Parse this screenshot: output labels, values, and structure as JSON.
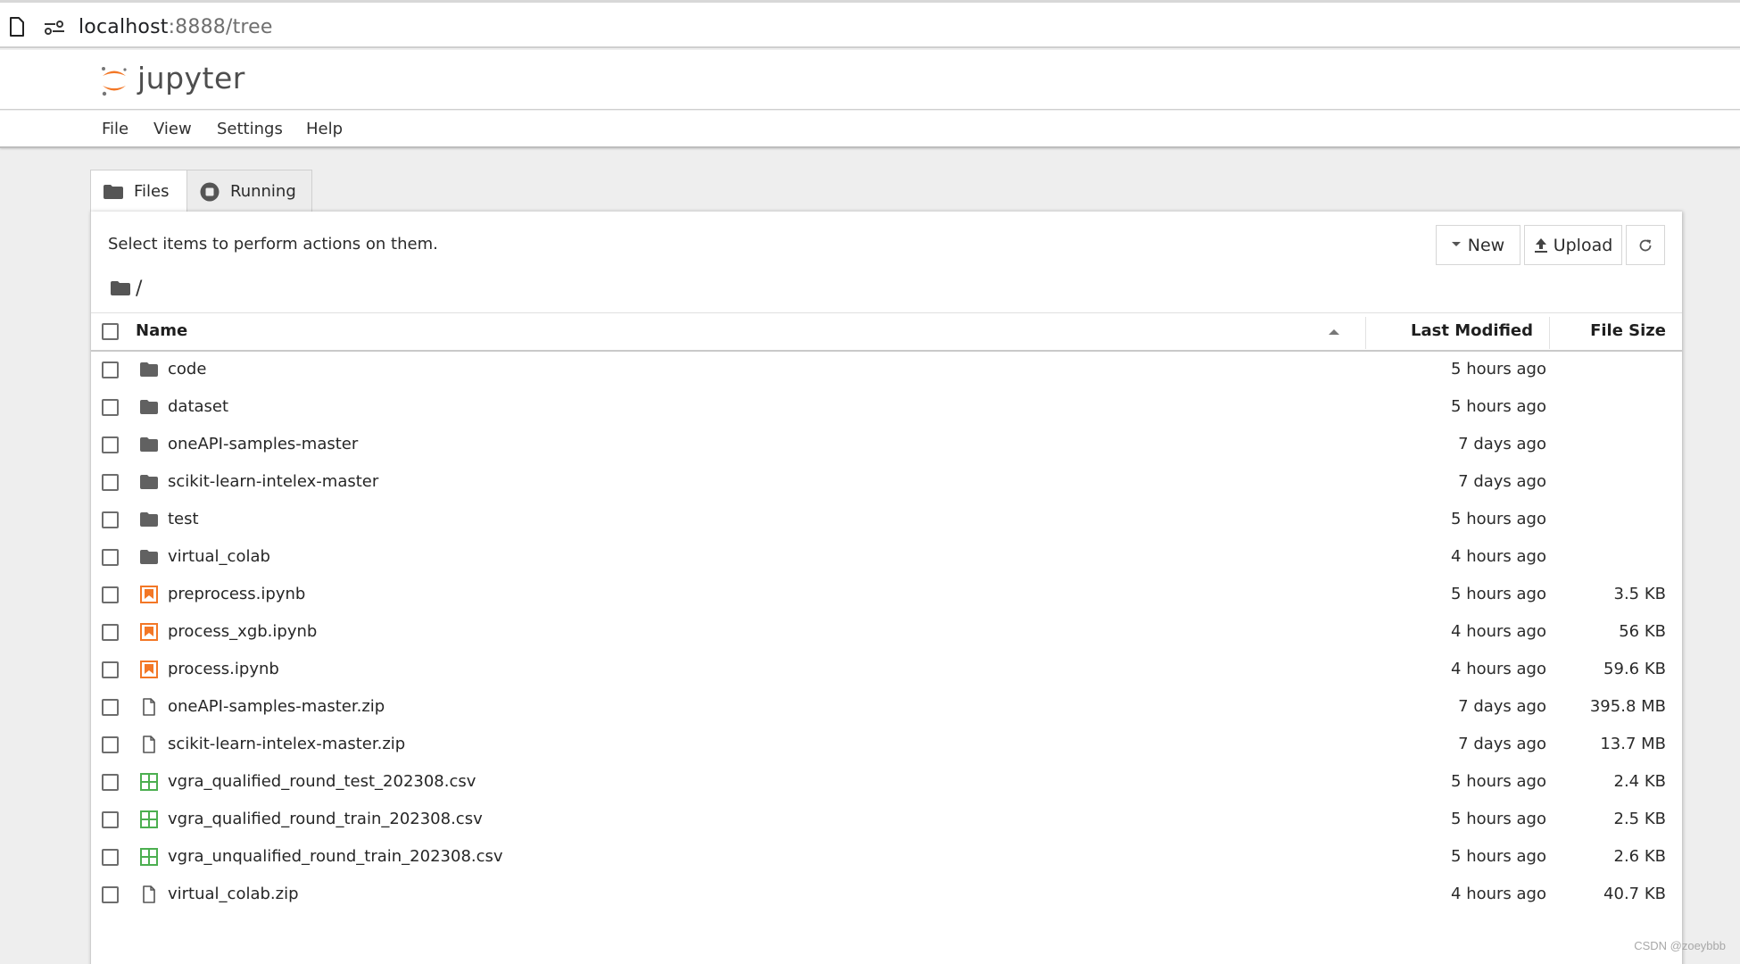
{
  "browser": {
    "url_host": "localhost",
    "url_rest": ":8888/tree"
  },
  "header": {
    "app_name": "jupyter",
    "brand_color": "#F37726"
  },
  "menu": {
    "items": [
      {
        "label": "File"
      },
      {
        "label": "View"
      },
      {
        "label": "Settings"
      },
      {
        "label": "Help"
      }
    ]
  },
  "tabs": [
    {
      "label": "Files",
      "icon": "folder-icon",
      "active": true
    },
    {
      "label": "Running",
      "icon": "stop-circle-icon",
      "active": false
    }
  ],
  "toolbar": {
    "hint": "Select items to perform actions on them.",
    "new_label": "New",
    "upload_label": "Upload",
    "refresh_icon": "refresh-icon"
  },
  "breadcrumb": {
    "path": "/"
  },
  "table": {
    "columns": {
      "name": "Name",
      "last_modified": "Last Modified",
      "file_size": "File Size"
    },
    "sort": {
      "column": "name",
      "direction": "ascending"
    },
    "rows": [
      {
        "name": "code",
        "type": "folder",
        "modified": "5 hours ago",
        "size": ""
      },
      {
        "name": "dataset",
        "type": "folder",
        "modified": "5 hours ago",
        "size": ""
      },
      {
        "name": "oneAPI-samples-master",
        "type": "folder",
        "modified": "7 days ago",
        "size": ""
      },
      {
        "name": "scikit-learn-intelex-master",
        "type": "folder",
        "modified": "7 days ago",
        "size": ""
      },
      {
        "name": "test",
        "type": "folder",
        "modified": "5 hours ago",
        "size": ""
      },
      {
        "name": "virtual_colab",
        "type": "folder",
        "modified": "4 hours ago",
        "size": ""
      },
      {
        "name": "preprocess.ipynb",
        "type": "notebook",
        "modified": "5 hours ago",
        "size": "3.5 KB"
      },
      {
        "name": "process_xgb.ipynb",
        "type": "notebook",
        "modified": "4 hours ago",
        "size": "56 KB"
      },
      {
        "name": "process.ipynb",
        "type": "notebook",
        "modified": "4 hours ago",
        "size": "59.6 KB"
      },
      {
        "name": "oneAPI-samples-master.zip",
        "type": "file",
        "modified": "7 days ago",
        "size": "395.8 MB"
      },
      {
        "name": "scikit-learn-intelex-master.zip",
        "type": "file",
        "modified": "7 days ago",
        "size": "13.7 MB"
      },
      {
        "name": "vgra_qualified_round_test_202308.csv",
        "type": "csv",
        "modified": "5 hours ago",
        "size": "2.4 KB"
      },
      {
        "name": "vgra_qualified_round_train_202308.csv",
        "type": "csv",
        "modified": "5 hours ago",
        "size": "2.5 KB"
      },
      {
        "name": "vgra_unqualified_round_train_202308.csv",
        "type": "csv",
        "modified": "5 hours ago",
        "size": "2.6 KB"
      },
      {
        "name": "virtual_colab.zip",
        "type": "file",
        "modified": "4 hours ago",
        "size": "40.7 KB"
      }
    ]
  },
  "colors": {
    "notebook_icon": "#F37726",
    "csv_icon": "#4CAF50",
    "folder_icon": "#616161"
  },
  "watermark": "CSDN @zoeybbb"
}
